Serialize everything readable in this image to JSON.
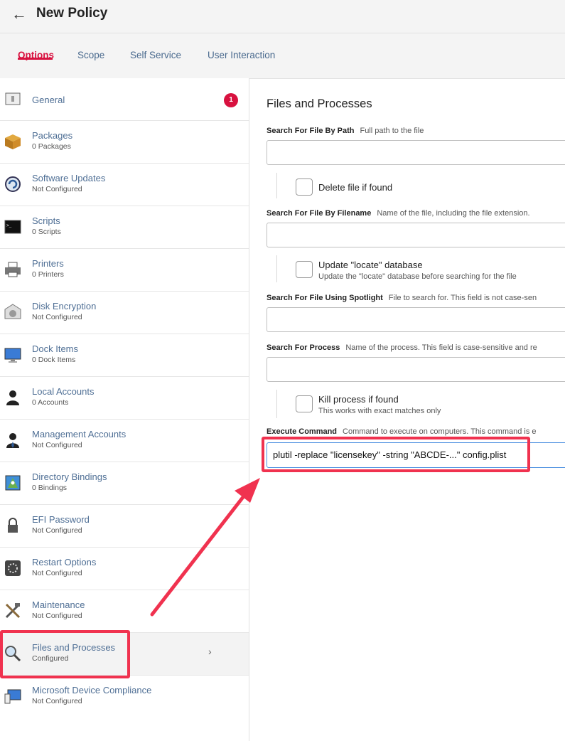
{
  "header": {
    "back_icon": "arrow-left-icon",
    "title": "New Policy"
  },
  "tabs": [
    {
      "label": "Options",
      "active": true
    },
    {
      "label": "Scope",
      "active": false
    },
    {
      "label": "Self Service",
      "active": false
    },
    {
      "label": "User Interaction",
      "active": false
    }
  ],
  "sidebar": {
    "items": [
      {
        "name": "General",
        "sub": "",
        "icon": "general-icon",
        "badge": "1"
      },
      {
        "name": "Packages",
        "sub": "0 Packages",
        "icon": "package-icon"
      },
      {
        "name": "Software Updates",
        "sub": "Not Configured",
        "icon": "software-update-icon"
      },
      {
        "name": "Scripts",
        "sub": "0 Scripts",
        "icon": "terminal-icon"
      },
      {
        "name": "Printers",
        "sub": "0 Printers",
        "icon": "printer-icon"
      },
      {
        "name": "Disk Encryption",
        "sub": "Not Configured",
        "icon": "disk-encryption-icon"
      },
      {
        "name": "Dock Items",
        "sub": "0 Dock Items",
        "icon": "monitor-icon"
      },
      {
        "name": "Local Accounts",
        "sub": "0 Accounts",
        "icon": "user-icon"
      },
      {
        "name": "Management Accounts",
        "sub": "Not Configured",
        "icon": "manager-icon"
      },
      {
        "name": "Directory Bindings",
        "sub": "0 Bindings",
        "icon": "directory-icon"
      },
      {
        "name": "EFI Password",
        "sub": "Not Configured",
        "icon": "lock-icon"
      },
      {
        "name": "Restart Options",
        "sub": "Not Configured",
        "icon": "restart-icon"
      },
      {
        "name": "Maintenance",
        "sub": "Not Configured",
        "icon": "tools-icon"
      },
      {
        "name": "Files and Processes",
        "sub": "Configured",
        "icon": "magnifier-icon",
        "selected": true
      },
      {
        "name": "Microsoft Device Compliance",
        "sub": "Not Configured",
        "icon": "device-compliance-icon"
      }
    ]
  },
  "main": {
    "section_title": "Files and Processes",
    "search_by_path": {
      "label": "Search For File By Path",
      "hint": "Full path to the file",
      "value": ""
    },
    "delete_file": {
      "label": "Delete file if found",
      "checked": false
    },
    "search_by_filename": {
      "label": "Search For File By Filename",
      "hint": "Name of the file, including the file extension.",
      "value": ""
    },
    "update_locate": {
      "label": "Update \"locate\" database",
      "hint": "Update the \"locate\" database before searching for the file",
      "checked": false
    },
    "search_spotlight": {
      "label": "Search For File Using Spotlight",
      "hint": "File to search for. This field is not case-sen",
      "value": ""
    },
    "search_process": {
      "label": "Search For Process",
      "hint": "Name of the process. This field is case-sensitive and re",
      "value": ""
    },
    "kill_process": {
      "label": "Kill process if found",
      "hint": "This works with exact matches only",
      "checked": false
    },
    "execute_command": {
      "label": "Execute Command",
      "hint": "Command to execute on computers. This command is e",
      "value": "plutil -replace \"licensekey\" -string \"ABCDE-...\" config.plist"
    }
  },
  "colors": {
    "accent": "#d8113f",
    "link": "#4f6f95",
    "annotation": "#f0324f",
    "focus": "#4a8fe0"
  }
}
